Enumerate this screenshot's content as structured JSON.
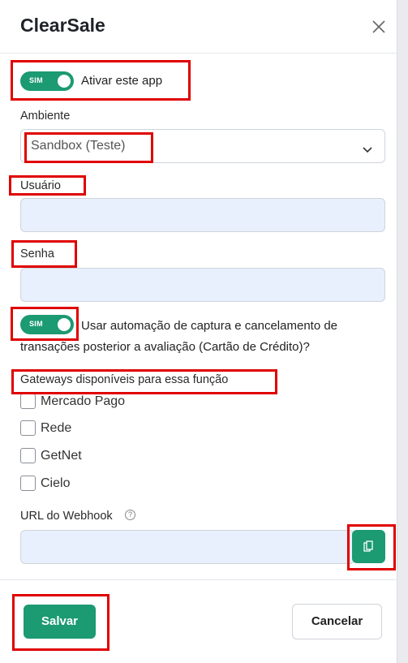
{
  "modal": {
    "title": "ClearSale",
    "activate_toggle": {
      "label": "SIM",
      "on": true
    },
    "activate_text": "Ativar este app",
    "environment": {
      "label": "Ambiente",
      "value": "Sandbox (Teste)"
    },
    "user": {
      "label": "Usuário",
      "value": ""
    },
    "password": {
      "label": "Senha",
      "value": ""
    },
    "automation_toggle": {
      "label": "SIM",
      "on": true
    },
    "automation_text_line1": "Usar automação de captura e cancelamento de",
    "automation_text_line2": "transações posterior a avaliação (Cartão de Crédito)?",
    "gateways_label": "Gateways disponíveis para essa função",
    "gateways": [
      {
        "label": "Mercado Pago",
        "checked": false
      },
      {
        "label": "Rede",
        "checked": false
      },
      {
        "label": "GetNet",
        "checked": false
      },
      {
        "label": "Cielo",
        "checked": false
      }
    ],
    "webhook": {
      "label": "URL do Webhook",
      "help": "?",
      "value": ""
    },
    "save_label": "Salvar",
    "cancel_label": "Cancelar"
  },
  "colors": {
    "accent": "#1c9a72",
    "highlight": "#e00000",
    "input_bg": "#e8f0fe"
  },
  "icons": [
    "close-icon",
    "chevron-down-icon",
    "help-icon",
    "copy-icon"
  ]
}
